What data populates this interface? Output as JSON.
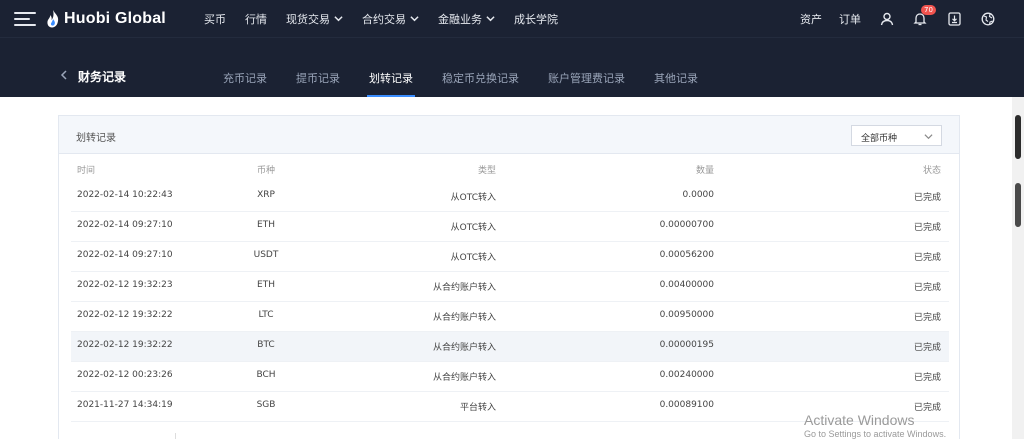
{
  "app": {
    "logo_text": "Huobi Global"
  },
  "nav": {
    "items": [
      {
        "label": "买币",
        "dropdown": false
      },
      {
        "label": "行情",
        "dropdown": false
      },
      {
        "label": "现货交易",
        "dropdown": true
      },
      {
        "label": "合约交易",
        "dropdown": true
      },
      {
        "label": "金融业务",
        "dropdown": true
      },
      {
        "label": "成长学院",
        "dropdown": false
      }
    ],
    "assets_label": "资产",
    "orders_label": "订单",
    "notification_count": "70"
  },
  "subheader": {
    "title": "财务记录",
    "tabs": [
      {
        "label": "充币记录",
        "active": false
      },
      {
        "label": "提币记录",
        "active": false
      },
      {
        "label": "划转记录",
        "active": true
      },
      {
        "label": "稳定币兑换记录",
        "active": false
      },
      {
        "label": "账户管理费记录",
        "active": false
      },
      {
        "label": "其他记录",
        "active": false
      }
    ]
  },
  "card": {
    "title": "划转记录",
    "filter_value": "全部币种",
    "columns": {
      "time": "时间",
      "coin": "币种",
      "type": "类型",
      "amount": "数量",
      "status": "状态"
    },
    "rows": [
      {
        "time": "2022-02-14 10:22:43",
        "coin": "XRP",
        "type": "从OTC转入",
        "amount": "0.0000",
        "status": "已完成"
      },
      {
        "time": "2022-02-14 09:27:10",
        "coin": "ETH",
        "type": "从OTC转入",
        "amount": "0.00000700",
        "status": "已完成"
      },
      {
        "time": "2022-02-14 09:27:10",
        "coin": "USDT",
        "type": "从OTC转入",
        "amount": "0.00056200",
        "status": "已完成"
      },
      {
        "time": "2022-02-12 19:32:23",
        "coin": "ETH",
        "type": "从合约账户转入",
        "amount": "0.00400000",
        "status": "已完成"
      },
      {
        "time": "2022-02-12 19:32:22",
        "coin": "LTC",
        "type": "从合约账户转入",
        "amount": "0.00950000",
        "status": "已完成"
      },
      {
        "time": "2022-02-12 19:32:22",
        "coin": "BTC",
        "type": "从合约账户转入",
        "amount": "0.00000195",
        "status": "已完成"
      },
      {
        "time": "2022-02-12 00:23:26",
        "coin": "BCH",
        "type": "从合约账户转入",
        "amount": "0.00240000",
        "status": "已完成"
      },
      {
        "time": "2021-11-27 14:34:19",
        "coin": "SGB",
        "type": "平台转入",
        "amount": "0.00089100",
        "status": "已完成"
      }
    ],
    "highlighted_row": 5
  },
  "watermark": {
    "line1": "Activate Windows",
    "line2": "Go to Settings to activate Windows."
  },
  "colors": {
    "nav_bg": "#1b2233",
    "accent": "#3a8dff",
    "badge": "#f0534e"
  }
}
